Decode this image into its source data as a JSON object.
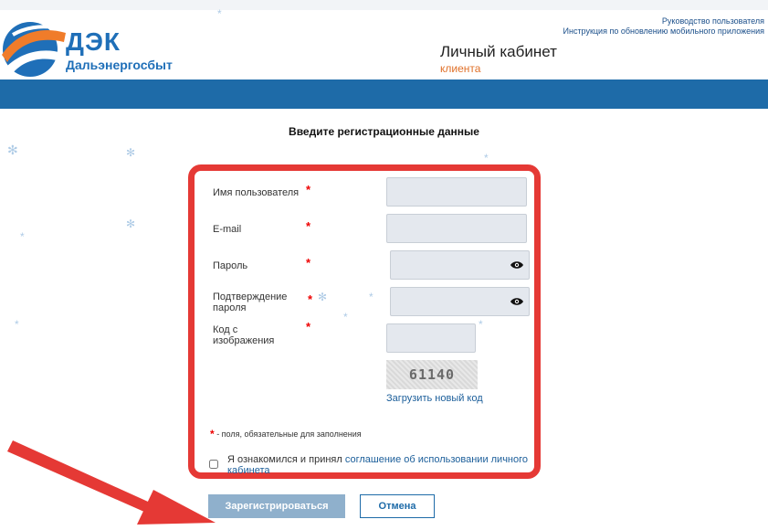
{
  "header": {
    "logo_title": "ДЭК",
    "logo_subtitle": "Дальэнергосбыт",
    "links": [
      "Руководство пользователя",
      "Инструкция по обновлению мобильного приложения"
    ],
    "title": "Личный кабинет",
    "subtitle": "клиента"
  },
  "form": {
    "heading": "Введите регистрационные данные",
    "fields": [
      {
        "label": "Имя пользователя",
        "value": ""
      },
      {
        "label": "E-mail",
        "value": ""
      },
      {
        "label": "Пароль",
        "value": ""
      },
      {
        "label": "Подтверждение пароля",
        "value": ""
      },
      {
        "label": "Код с изображения",
        "value": ""
      }
    ],
    "captcha_text": "61140",
    "new_code_link": "Загрузить новый код",
    "required_note": "- поля, обязательные для заполнения",
    "agree_text": "Я ознакомился и принял",
    "agree_link": "соглашение об использовании личного кабинета",
    "agree_checked": false,
    "register_button": "Зарегистрироваться",
    "cancel_button": "Отмена"
  },
  "colors": {
    "brand_blue": "#1e6ba8",
    "accent_orange": "#e0712a",
    "highlight_red": "#e53935"
  }
}
